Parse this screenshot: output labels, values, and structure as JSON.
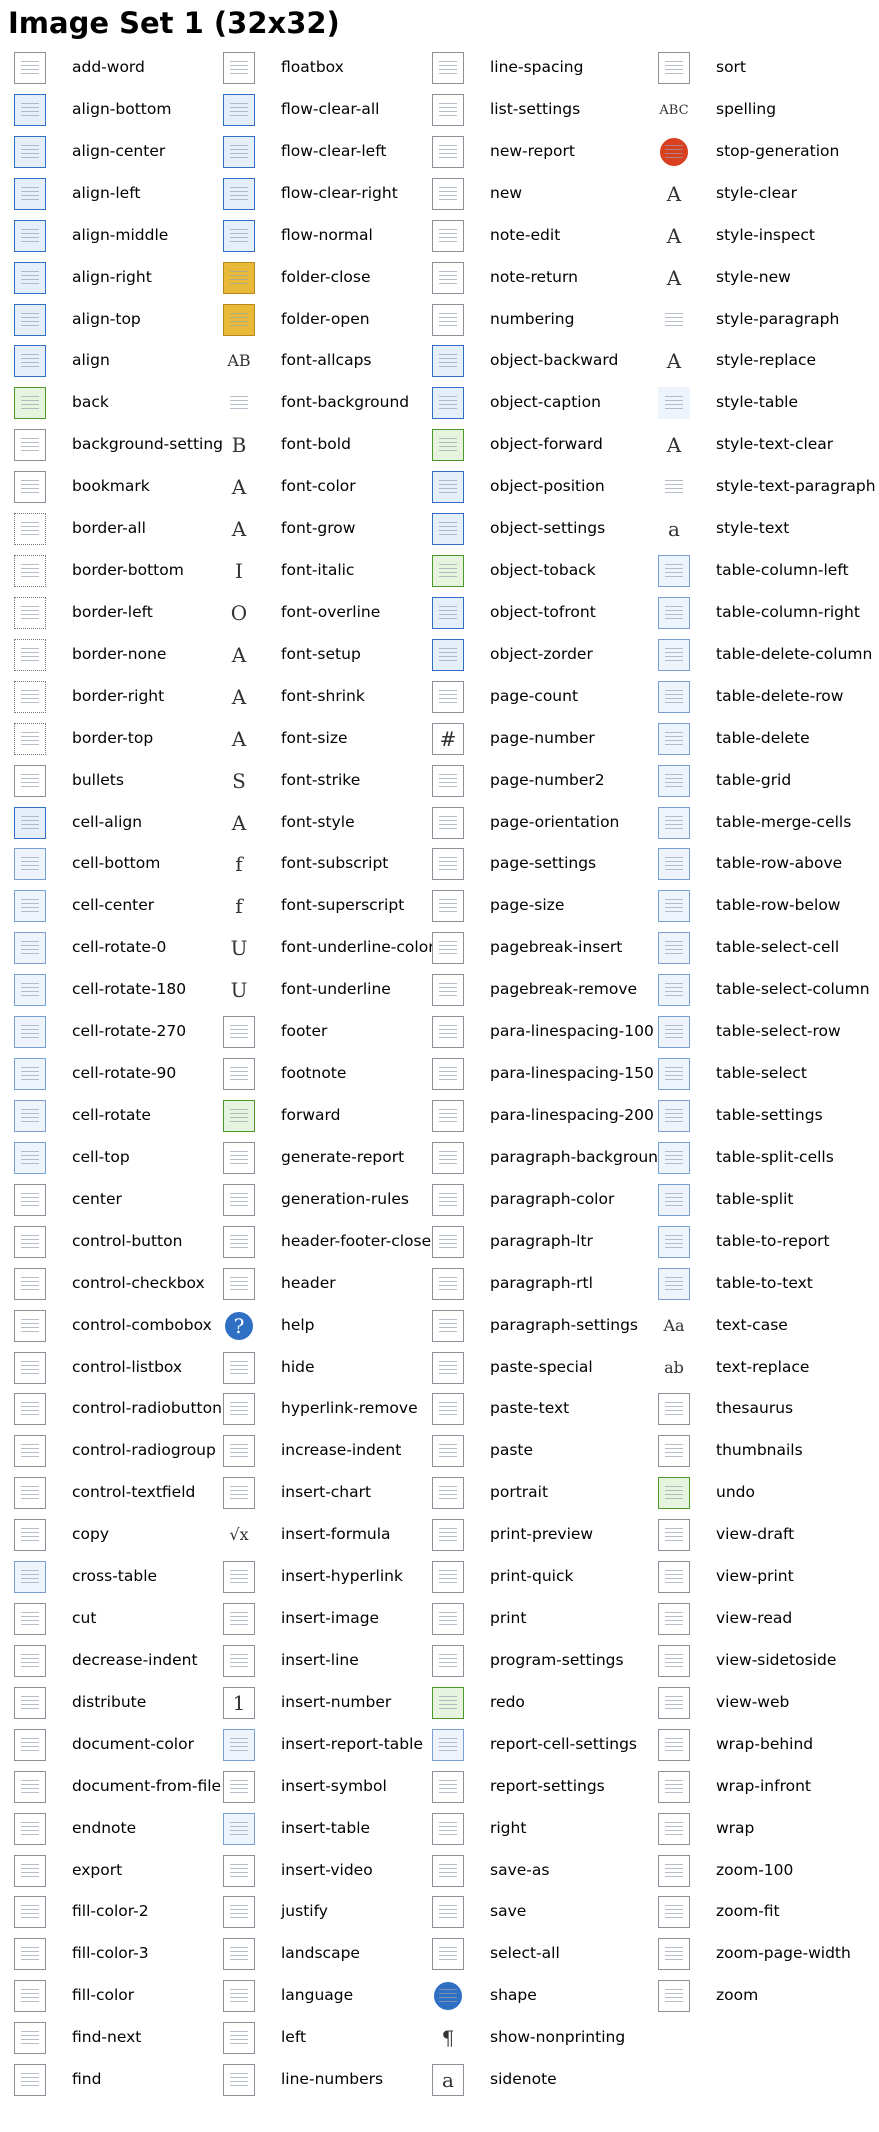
{
  "title": "Image Set 1 (32x32)",
  "columns": [
    [
      {
        "label": "add-word",
        "icon": "add-word-icon"
      },
      {
        "label": "align-bottom",
        "icon": "align-bottom-icon"
      },
      {
        "label": "align-center",
        "icon": "align-center-icon"
      },
      {
        "label": "align-left",
        "icon": "align-left-icon"
      },
      {
        "label": "align-middle",
        "icon": "align-middle-icon"
      },
      {
        "label": "align-right",
        "icon": "align-right-icon"
      },
      {
        "label": "align-top",
        "icon": "align-top-icon"
      },
      {
        "label": "align",
        "icon": "align-icon"
      },
      {
        "label": "back",
        "icon": "back-icon"
      },
      {
        "label": "background-settings",
        "icon": "background-settings-icon"
      },
      {
        "label": "bookmark",
        "icon": "bookmark-icon"
      },
      {
        "label": "border-all",
        "icon": "border-all-icon"
      },
      {
        "label": "border-bottom",
        "icon": "border-bottom-icon"
      },
      {
        "label": "border-left",
        "icon": "border-left-icon"
      },
      {
        "label": "border-none",
        "icon": "border-none-icon"
      },
      {
        "label": "border-right",
        "icon": "border-right-icon"
      },
      {
        "label": "border-top",
        "icon": "border-top-icon"
      },
      {
        "label": "bullets",
        "icon": "bullets-icon"
      },
      {
        "label": "cell-align",
        "icon": "cell-align-icon"
      },
      {
        "label": "cell-bottom",
        "icon": "cell-bottom-icon"
      },
      {
        "label": "cell-center",
        "icon": "cell-center-icon"
      },
      {
        "label": "cell-rotate-0",
        "icon": "cell-rotate-0-icon"
      },
      {
        "label": "cell-rotate-180",
        "icon": "cell-rotate-180-icon"
      },
      {
        "label": "cell-rotate-270",
        "icon": "cell-rotate-270-icon"
      },
      {
        "label": "cell-rotate-90",
        "icon": "cell-rotate-90-icon"
      },
      {
        "label": "cell-rotate",
        "icon": "cell-rotate-icon"
      },
      {
        "label": "cell-top",
        "icon": "cell-top-icon"
      },
      {
        "label": "center",
        "icon": "center-icon"
      },
      {
        "label": "control-button",
        "icon": "control-button-icon"
      },
      {
        "label": "control-checkbox",
        "icon": "control-checkbox-icon"
      },
      {
        "label": "control-combobox",
        "icon": "control-combobox-icon"
      },
      {
        "label": "control-listbox",
        "icon": "control-listbox-icon"
      },
      {
        "label": "control-radiobutton",
        "icon": "control-radiobutton-icon"
      },
      {
        "label": "control-radiogroup",
        "icon": "control-radiogroup-icon"
      },
      {
        "label": "control-textfield",
        "icon": "control-textfield-icon"
      },
      {
        "label": "copy",
        "icon": "copy-icon"
      },
      {
        "label": "cross-table",
        "icon": "cross-table-icon"
      },
      {
        "label": "cut",
        "icon": "cut-icon"
      },
      {
        "label": "decrease-indent",
        "icon": "decrease-indent-icon"
      },
      {
        "label": "distribute",
        "icon": "distribute-icon"
      },
      {
        "label": "document-color",
        "icon": "document-color-icon"
      },
      {
        "label": "document-from-file",
        "icon": "document-from-file-icon"
      },
      {
        "label": "endnote",
        "icon": "endnote-icon"
      },
      {
        "label": "export",
        "icon": "export-icon"
      },
      {
        "label": "fill-color-2",
        "icon": "fill-color-2-icon"
      },
      {
        "label": "fill-color-3",
        "icon": "fill-color-3-icon"
      },
      {
        "label": "fill-color",
        "icon": "fill-color-icon"
      },
      {
        "label": "find-next",
        "icon": "find-next-icon"
      },
      {
        "label": "find",
        "icon": "find-icon"
      }
    ],
    [
      {
        "label": "floatbox",
        "icon": "floatbox-icon"
      },
      {
        "label": "flow-clear-all",
        "icon": "flow-clear-all-icon"
      },
      {
        "label": "flow-clear-left",
        "icon": "flow-clear-left-icon"
      },
      {
        "label": "flow-clear-right",
        "icon": "flow-clear-right-icon"
      },
      {
        "label": "flow-normal",
        "icon": "flow-normal-icon"
      },
      {
        "label": "folder-close",
        "icon": "folder-close-icon"
      },
      {
        "label": "folder-open",
        "icon": "folder-open-icon"
      },
      {
        "label": "font-allcaps",
        "icon": "font-allcaps-icon",
        "glyph": "AB"
      },
      {
        "label": "font-background",
        "icon": "font-background-icon"
      },
      {
        "label": "font-bold",
        "icon": "font-bold-icon",
        "glyph": "B"
      },
      {
        "label": "font-color",
        "icon": "font-color-icon",
        "glyph": "A"
      },
      {
        "label": "font-grow",
        "icon": "font-grow-icon",
        "glyph": "A"
      },
      {
        "label": "font-italic",
        "icon": "font-italic-icon",
        "glyph": "I"
      },
      {
        "label": "font-overline",
        "icon": "font-overline-icon",
        "glyph": "O"
      },
      {
        "label": "font-setup",
        "icon": "font-setup-icon",
        "glyph": "A"
      },
      {
        "label": "font-shrink",
        "icon": "font-shrink-icon",
        "glyph": "A"
      },
      {
        "label": "font-size",
        "icon": "font-size-icon",
        "glyph": "A"
      },
      {
        "label": "font-strike",
        "icon": "font-strike-icon",
        "glyph": "S"
      },
      {
        "label": "font-style",
        "icon": "font-style-icon",
        "glyph": "A"
      },
      {
        "label": "font-subscript",
        "icon": "font-subscript-icon",
        "glyph": "f"
      },
      {
        "label": "font-superscript",
        "icon": "font-superscript-icon",
        "glyph": "f"
      },
      {
        "label": "font-underline-color",
        "icon": "font-underline-color-icon",
        "glyph": "U"
      },
      {
        "label": "font-underline",
        "icon": "font-underline-icon",
        "glyph": "U"
      },
      {
        "label": "footer",
        "icon": "footer-icon"
      },
      {
        "label": "footnote",
        "icon": "footnote-icon"
      },
      {
        "label": "forward",
        "icon": "forward-icon"
      },
      {
        "label": "generate-report",
        "icon": "generate-report-icon"
      },
      {
        "label": "generation-rules",
        "icon": "generation-rules-icon"
      },
      {
        "label": "header-footer-close",
        "icon": "header-footer-close-icon"
      },
      {
        "label": "header",
        "icon": "header-icon"
      },
      {
        "label": "help",
        "icon": "help-icon",
        "glyph": "?"
      },
      {
        "label": "hide",
        "icon": "hide-icon"
      },
      {
        "label": "hyperlink-remove",
        "icon": "hyperlink-remove-icon"
      },
      {
        "label": "increase-indent",
        "icon": "increase-indent-icon"
      },
      {
        "label": "insert-chart",
        "icon": "insert-chart-icon"
      },
      {
        "label": "insert-formula",
        "icon": "insert-formula-icon",
        "glyph": "√x"
      },
      {
        "label": "insert-hyperlink",
        "icon": "insert-hyperlink-icon"
      },
      {
        "label": "insert-image",
        "icon": "insert-image-icon"
      },
      {
        "label": "insert-line",
        "icon": "insert-line-icon"
      },
      {
        "label": "insert-number",
        "icon": "insert-number-icon",
        "glyph": "1"
      },
      {
        "label": "insert-report-table",
        "icon": "insert-report-table-icon"
      },
      {
        "label": "insert-symbol",
        "icon": "insert-symbol-icon"
      },
      {
        "label": "insert-table",
        "icon": "insert-table-icon"
      },
      {
        "label": "insert-video",
        "icon": "insert-video-icon"
      },
      {
        "label": "justify",
        "icon": "justify-icon"
      },
      {
        "label": "landscape",
        "icon": "landscape-icon"
      },
      {
        "label": "language",
        "icon": "language-icon"
      },
      {
        "label": "left",
        "icon": "left-icon"
      },
      {
        "label": "line-numbers",
        "icon": "line-numbers-icon"
      }
    ],
    [
      {
        "label": "line-spacing",
        "icon": "line-spacing-icon"
      },
      {
        "label": "list-settings",
        "icon": "list-settings-icon"
      },
      {
        "label": "new-report",
        "icon": "new-report-icon"
      },
      {
        "label": "new",
        "icon": "new-icon"
      },
      {
        "label": "note-edit",
        "icon": "note-edit-icon"
      },
      {
        "label": "note-return",
        "icon": "note-return-icon"
      },
      {
        "label": "numbering",
        "icon": "numbering-icon"
      },
      {
        "label": "object-backward",
        "icon": "object-backward-icon"
      },
      {
        "label": "object-caption",
        "icon": "object-caption-icon"
      },
      {
        "label": "object-forward",
        "icon": "object-forward-icon"
      },
      {
        "label": "object-position",
        "icon": "object-position-icon"
      },
      {
        "label": "object-settings",
        "icon": "object-settings-icon"
      },
      {
        "label": "object-toback",
        "icon": "object-toback-icon"
      },
      {
        "label": "object-tofront",
        "icon": "object-tofront-icon"
      },
      {
        "label": "object-zorder",
        "icon": "object-zorder-icon"
      },
      {
        "label": "page-count",
        "icon": "page-count-icon"
      },
      {
        "label": "page-number",
        "icon": "page-number-icon",
        "glyph": "#"
      },
      {
        "label": "page-number2",
        "icon": "page-number2-icon"
      },
      {
        "label": "page-orientation",
        "icon": "page-orientation-icon"
      },
      {
        "label": "page-settings",
        "icon": "page-settings-icon"
      },
      {
        "label": "page-size",
        "icon": "page-size-icon"
      },
      {
        "label": "pagebreak-insert",
        "icon": "pagebreak-insert-icon"
      },
      {
        "label": "pagebreak-remove",
        "icon": "pagebreak-remove-icon"
      },
      {
        "label": "para-linespacing-100",
        "icon": "para-linespacing-100-icon"
      },
      {
        "label": "para-linespacing-150",
        "icon": "para-linespacing-150-icon"
      },
      {
        "label": "para-linespacing-200",
        "icon": "para-linespacing-200-icon"
      },
      {
        "label": "paragraph-background",
        "icon": "paragraph-background-icon"
      },
      {
        "label": "paragraph-color",
        "icon": "paragraph-color-icon"
      },
      {
        "label": "paragraph-ltr",
        "icon": "paragraph-ltr-icon"
      },
      {
        "label": "paragraph-rtl",
        "icon": "paragraph-rtl-icon"
      },
      {
        "label": "paragraph-settings",
        "icon": "paragraph-settings-icon"
      },
      {
        "label": "paste-special",
        "icon": "paste-special-icon"
      },
      {
        "label": "paste-text",
        "icon": "paste-text-icon"
      },
      {
        "label": "paste",
        "icon": "paste-icon"
      },
      {
        "label": "portrait",
        "icon": "portrait-icon"
      },
      {
        "label": "print-preview",
        "icon": "print-preview-icon"
      },
      {
        "label": "print-quick",
        "icon": "print-quick-icon"
      },
      {
        "label": "print",
        "icon": "print-icon"
      },
      {
        "label": "program-settings",
        "icon": "program-settings-icon"
      },
      {
        "label": "redo",
        "icon": "redo-icon"
      },
      {
        "label": "report-cell-settings",
        "icon": "report-cell-settings-icon"
      },
      {
        "label": "report-settings",
        "icon": "report-settings-icon"
      },
      {
        "label": "right",
        "icon": "right-icon"
      },
      {
        "label": "save-as",
        "icon": "save-as-icon"
      },
      {
        "label": "save",
        "icon": "save-icon"
      },
      {
        "label": "select-all",
        "icon": "select-all-icon"
      },
      {
        "label": "shape",
        "icon": "shape-icon"
      },
      {
        "label": "show-nonprinting",
        "icon": "show-nonprinting-icon",
        "glyph": "¶"
      },
      {
        "label": "sidenote",
        "icon": "sidenote-icon",
        "glyph": "a"
      }
    ],
    [
      {
        "label": "sort",
        "icon": "sort-icon"
      },
      {
        "label": "spelling",
        "icon": "spelling-icon",
        "glyph": "ABC"
      },
      {
        "label": "stop-generation",
        "icon": "stop-generation-icon"
      },
      {
        "label": "style-clear",
        "icon": "style-clear-icon",
        "glyph": "A"
      },
      {
        "label": "style-inspect",
        "icon": "style-inspect-icon",
        "glyph": "A"
      },
      {
        "label": "style-new",
        "icon": "style-new-icon",
        "glyph": "A"
      },
      {
        "label": "style-paragraph",
        "icon": "style-paragraph-icon"
      },
      {
        "label": "style-replace",
        "icon": "style-replace-icon",
        "glyph": "A"
      },
      {
        "label": "style-table",
        "icon": "style-table-icon"
      },
      {
        "label": "style-text-clear",
        "icon": "style-text-clear-icon",
        "glyph": "A"
      },
      {
        "label": "style-text-paragraph",
        "icon": "style-text-paragraph-icon"
      },
      {
        "label": "style-text",
        "icon": "style-text-icon",
        "glyph": "a"
      },
      {
        "label": "table-column-left",
        "icon": "table-column-left-icon"
      },
      {
        "label": "table-column-right",
        "icon": "table-column-right-icon"
      },
      {
        "label": "table-delete-column",
        "icon": "table-delete-column-icon"
      },
      {
        "label": "table-delete-row",
        "icon": "table-delete-row-icon"
      },
      {
        "label": "table-delete",
        "icon": "table-delete-icon"
      },
      {
        "label": "table-grid",
        "icon": "table-grid-icon"
      },
      {
        "label": "table-merge-cells",
        "icon": "table-merge-cells-icon"
      },
      {
        "label": "table-row-above",
        "icon": "table-row-above-icon"
      },
      {
        "label": "table-row-below",
        "icon": "table-row-below-icon"
      },
      {
        "label": "table-select-cell",
        "icon": "table-select-cell-icon"
      },
      {
        "label": "table-select-column",
        "icon": "table-select-column-icon"
      },
      {
        "label": "table-select-row",
        "icon": "table-select-row-icon"
      },
      {
        "label": "table-select",
        "icon": "table-select-icon"
      },
      {
        "label": "table-settings",
        "icon": "table-settings-icon"
      },
      {
        "label": "table-split-cells",
        "icon": "table-split-cells-icon"
      },
      {
        "label": "table-split",
        "icon": "table-split-icon"
      },
      {
        "label": "table-to-report",
        "icon": "table-to-report-icon"
      },
      {
        "label": "table-to-text",
        "icon": "table-to-text-icon"
      },
      {
        "label": "text-case",
        "icon": "text-case-icon",
        "glyph": "Aa"
      },
      {
        "label": "text-replace",
        "icon": "text-replace-icon",
        "glyph": "ab"
      },
      {
        "label": "thesaurus",
        "icon": "thesaurus-icon"
      },
      {
        "label": "thumbnails",
        "icon": "thumbnails-icon"
      },
      {
        "label": "undo",
        "icon": "undo-icon"
      },
      {
        "label": "view-draft",
        "icon": "view-draft-icon"
      },
      {
        "label": "view-print",
        "icon": "view-print-icon"
      },
      {
        "label": "view-read",
        "icon": "view-read-icon"
      },
      {
        "label": "view-sidetoside",
        "icon": "view-sidetoside-icon"
      },
      {
        "label": "view-web",
        "icon": "view-web-icon"
      },
      {
        "label": "wrap-behind",
        "icon": "wrap-behind-icon"
      },
      {
        "label": "wrap-infront",
        "icon": "wrap-infront-icon"
      },
      {
        "label": "wrap",
        "icon": "wrap-icon"
      },
      {
        "label": "zoom-100",
        "icon": "zoom-100-icon"
      },
      {
        "label": "zoom-fit",
        "icon": "zoom-fit-icon"
      },
      {
        "label": "zoom-page-width",
        "icon": "zoom-page-width-icon"
      },
      {
        "label": "zoom",
        "icon": "zoom-icon"
      }
    ]
  ],
  "colors": {
    "blue": "#2f6fc4",
    "green": "#4a9a2a",
    "red": "#d8401f",
    "orange": "#e8902a",
    "gray": "#8a8f98",
    "folder": "#e9b93a"
  }
}
